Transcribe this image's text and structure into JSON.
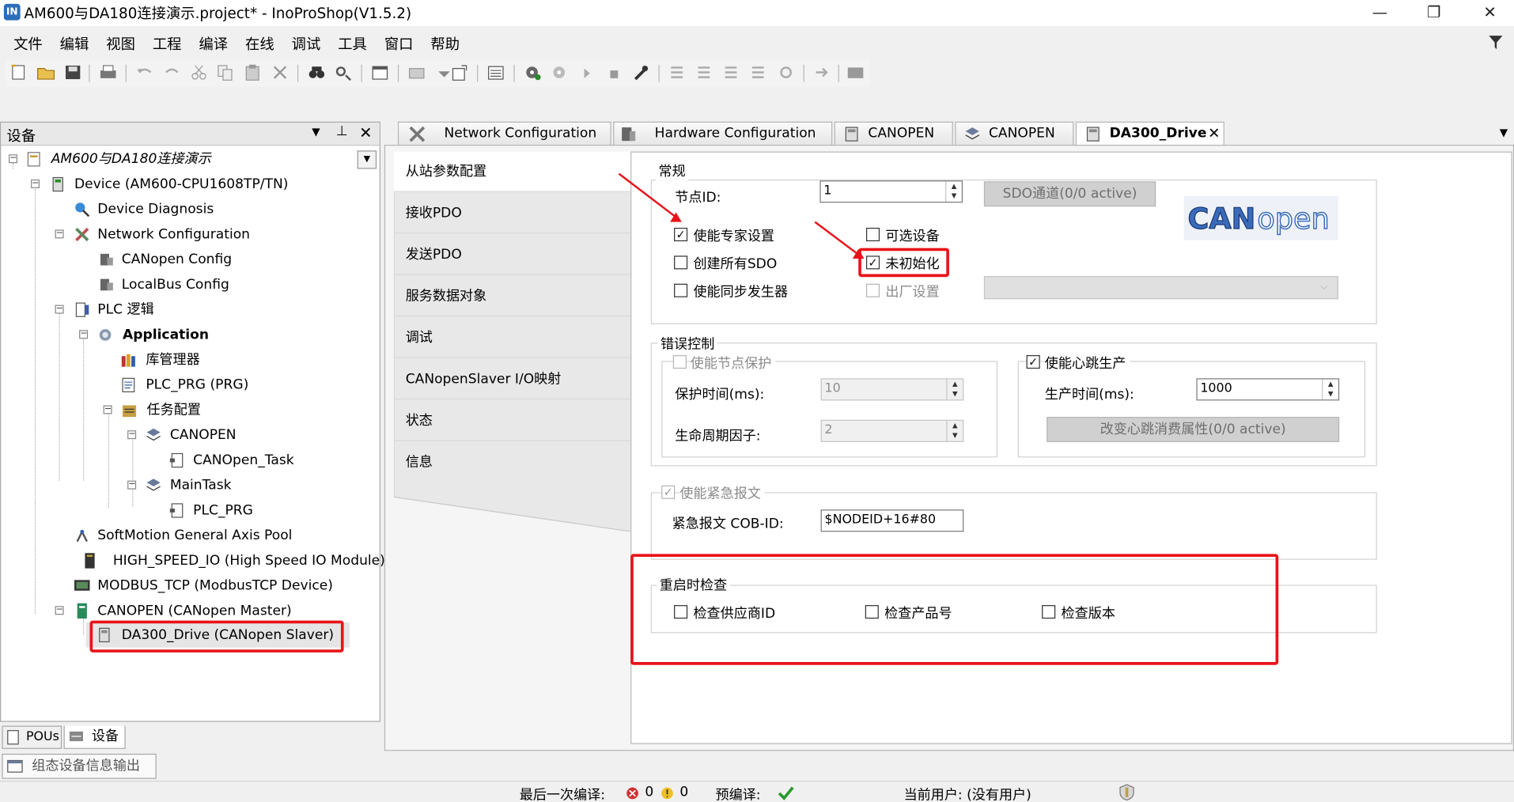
{
  "window": {
    "title": "AM600与DA180连接演示.project* - InoProShop(V1.5.2)",
    "minimize": "—",
    "maximize": "❐",
    "close": "✕"
  },
  "menu": [
    "文件",
    "编辑",
    "视图",
    "工程",
    "编译",
    "在线",
    "调试",
    "工具",
    "窗口",
    "帮助"
  ],
  "filter_icon": "filter-icon",
  "device_panel": {
    "title": "设备",
    "tree": [
      {
        "label": "AM600与DA180连接演示",
        "icon": "project-icon",
        "italic": true
      },
      {
        "label": "Device (AM600-CPU1608TP/TN)",
        "icon": "device-icon"
      },
      {
        "label": "Device Diagnosis",
        "icon": "diagnosis-icon"
      },
      {
        "label": "Network Configuration",
        "icon": "network-config-icon"
      },
      {
        "label": "CANopen Config",
        "icon": "canopen-config-icon"
      },
      {
        "label": "LocalBus Config",
        "icon": "localbus-config-icon"
      },
      {
        "label": "PLC 逻辑",
        "icon": "plc-logic-icon"
      },
      {
        "label": "Application",
        "icon": "application-icon",
        "bold": true
      },
      {
        "label": "库管理器",
        "icon": "library-manager-icon"
      },
      {
        "label": "PLC_PRG (PRG)",
        "icon": "program-icon"
      },
      {
        "label": "任务配置",
        "icon": "task-config-icon"
      },
      {
        "label": "CANOPEN",
        "icon": "task-icon"
      },
      {
        "label": "CANOpen_Task",
        "icon": "pou-call-icon"
      },
      {
        "label": "MainTask",
        "icon": "task-icon"
      },
      {
        "label": "PLC_PRG",
        "icon": "pou-call-icon"
      },
      {
        "label": "SoftMotion General Axis Pool",
        "icon": "axis-pool-icon"
      },
      {
        "label": "HIGH_SPEED_IO (High Speed IO Module)",
        "icon": "io-module-icon"
      },
      {
        "label": "MODBUS_TCP (ModbusTCP Device)",
        "icon": "modbus-icon"
      },
      {
        "label": "CANOPEN (CANopen Master)",
        "icon": "canopen-master-icon"
      },
      {
        "label": "DA300_Drive (CANopen Slaver)",
        "icon": "canopen-slave-icon"
      }
    ],
    "bottom_tabs": [
      "POUs",
      "设备"
    ],
    "output_tab": "组态设备信息输出"
  },
  "tabs": [
    {
      "label": "Network Configuration",
      "icon": "network-config-icon"
    },
    {
      "label": "Hardware Configuration",
      "icon": "hardware-config-icon"
    },
    {
      "label": "CANOPEN",
      "icon": "canopen-config-icon"
    },
    {
      "label": "CANOPEN",
      "icon": "task-icon"
    },
    {
      "label": "DA300_Drive",
      "icon": "canopen-slave-icon",
      "active": true
    }
  ],
  "side_nav": [
    "从站参数配置",
    "接收PDO",
    "发送PDO",
    "服务数据对象",
    "调试",
    "CANopenSlaver I/O映射",
    "状态",
    "信息"
  ],
  "general": {
    "title": "常规",
    "node_id_label": "节点ID:",
    "node_id": "1",
    "sdo_button": "SDO通道(0/0 active)",
    "logo_text": "CANopen",
    "enable_expert": {
      "label": "使能专家设置",
      "checked": true
    },
    "optional_device": {
      "label": "可选设备",
      "checked": false
    },
    "create_all_sdo": {
      "label": "创建所有SDO",
      "checked": false
    },
    "no_init": {
      "label": "未初始化",
      "checked": true
    },
    "enable_sync": {
      "label": "使能同步发生器",
      "checked": false
    },
    "factory_settings": {
      "label": "出厂设置",
      "checked": false
    }
  },
  "error_control": {
    "title": "错误控制",
    "node_guarding": {
      "label": "使能节点保护",
      "checked": false
    },
    "guard_time_label": "保护时间(ms):",
    "guard_time": "10",
    "life_factor_label": "生命周期因子:",
    "life_factor": "2",
    "heartbeat": {
      "label": "使能心跳生产",
      "checked": true
    },
    "producer_time_label": "生产时间(ms):",
    "producer_time": "1000",
    "heartbeat_button": "改变心跳消费属性(0/0 active)"
  },
  "emergency": {
    "label": "使能紧急报文",
    "checked": true,
    "cob_id_label": "紧急报文 COB-ID:",
    "cob_id": "$NODEID+16#80"
  },
  "restart_check": {
    "title": "重启时检查",
    "vendor_id": {
      "label": "检查供应商ID",
      "checked": false
    },
    "product_no": {
      "label": "检查产品号",
      "checked": false
    },
    "version": {
      "label": "检查版本",
      "checked": false
    }
  },
  "status_bar": {
    "last_build_label": "最后一次编译:",
    "errors": "0",
    "warnings": "0",
    "precompile_label": "预编译:",
    "current_user": "当前用户: (没有用户)"
  },
  "colors": {
    "highlight_red": "#e8131a",
    "accent_blue": "#2b6db8"
  }
}
